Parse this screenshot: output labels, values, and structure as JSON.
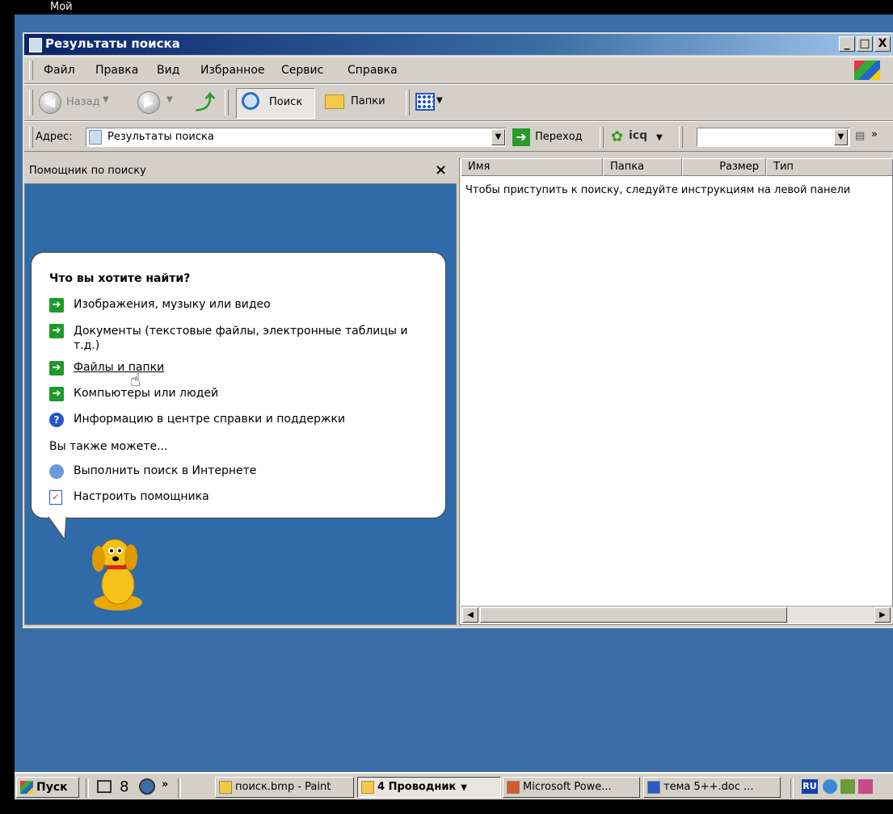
{
  "desktop": {
    "label": "Мой"
  },
  "window": {
    "title": "Результаты поиска",
    "caption_buttons": {
      "minimize": "_",
      "maximize": "□",
      "close": "X"
    }
  },
  "menu": [
    "Файл",
    "Правка",
    "Вид",
    "Избранное",
    "Сервис",
    "Справка"
  ],
  "toolbar": {
    "back_label": "Назад",
    "search_label": "Поиск",
    "folders_label": "Папки"
  },
  "address": {
    "label": "Адрес:",
    "value": "Результаты поиска",
    "go_label": "Переход",
    "icq_label": "icq",
    "more": "»"
  },
  "search_pane": {
    "header": "Помощник по поиску",
    "close": "×",
    "question": "Что вы хотите найти?",
    "options": [
      "Изображения, музыку или видео",
      "Документы (текстовые файлы, электронные таблицы и т.д.)",
      "Файлы и папки",
      "Компьютеры или людей",
      "Информацию в центре справки и поддержки"
    ],
    "also_label": "Вы также можете...",
    "also": [
      "Выполнить поиск в Интернете",
      "Настроить помощника"
    ]
  },
  "results": {
    "columns": [
      "Имя",
      "Папка",
      "Размер",
      "Тип"
    ],
    "hint": "Чтобы приступить к поиску, следуйте инструкциям на левой панели"
  },
  "taskbar": {
    "start": "Пуск",
    "quick_more": "»",
    "buttons": [
      "поиск.bmp - Paint",
      "4 Проводник",
      "Microsoft Powe...",
      "тема 5++.doc ..."
    ],
    "lang": "RU"
  },
  "colors": {
    "desktop": "#3a6ea5",
    "titlebar": "#0a246a",
    "pane": "#2f6ba8",
    "chrome": "#d4d0c8"
  }
}
